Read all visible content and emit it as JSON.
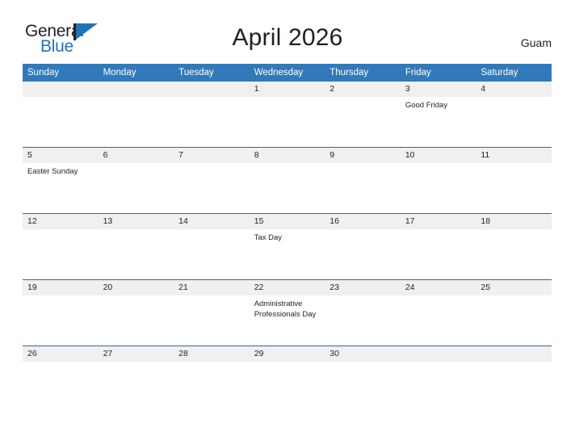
{
  "brand": {
    "name_part1": "General",
    "name_part2": "Blue",
    "color_dark": "#231f20",
    "color_blue": "#2272b6"
  },
  "header": {
    "title": "April 2026",
    "location": "Guam"
  },
  "calendar": {
    "accent_header_bg": "#3079ba",
    "day_strip_bg": "#f0f0f0",
    "rule_color": "#31679b",
    "weekday_headers": [
      "Sunday",
      "Monday",
      "Tuesday",
      "Wednesday",
      "Thursday",
      "Friday",
      "Saturday"
    ],
    "weeks": [
      [
        {
          "day": "",
          "events": []
        },
        {
          "day": "",
          "events": []
        },
        {
          "day": "",
          "events": []
        },
        {
          "day": "1",
          "events": []
        },
        {
          "day": "2",
          "events": []
        },
        {
          "day": "3",
          "events": [
            "Good Friday"
          ]
        },
        {
          "day": "4",
          "events": []
        }
      ],
      [
        {
          "day": "5",
          "events": [
            "Easter Sunday"
          ]
        },
        {
          "day": "6",
          "events": []
        },
        {
          "day": "7",
          "events": []
        },
        {
          "day": "8",
          "events": []
        },
        {
          "day": "9",
          "events": []
        },
        {
          "day": "10",
          "events": []
        },
        {
          "day": "11",
          "events": []
        }
      ],
      [
        {
          "day": "12",
          "events": []
        },
        {
          "day": "13",
          "events": []
        },
        {
          "day": "14",
          "events": []
        },
        {
          "day": "15",
          "events": [
            "Tax Day"
          ]
        },
        {
          "day": "16",
          "events": []
        },
        {
          "day": "17",
          "events": []
        },
        {
          "day": "18",
          "events": []
        }
      ],
      [
        {
          "day": "19",
          "events": []
        },
        {
          "day": "20",
          "events": []
        },
        {
          "day": "21",
          "events": []
        },
        {
          "day": "22",
          "events": [
            "Administrative",
            "Professionals Day"
          ]
        },
        {
          "day": "23",
          "events": []
        },
        {
          "day": "24",
          "events": []
        },
        {
          "day": "25",
          "events": []
        }
      ],
      [
        {
          "day": "26",
          "events": []
        },
        {
          "day": "27",
          "events": []
        },
        {
          "day": "28",
          "events": []
        },
        {
          "day": "29",
          "events": []
        },
        {
          "day": "30",
          "events": []
        },
        {
          "day": "",
          "events": []
        },
        {
          "day": "",
          "events": []
        }
      ]
    ]
  }
}
